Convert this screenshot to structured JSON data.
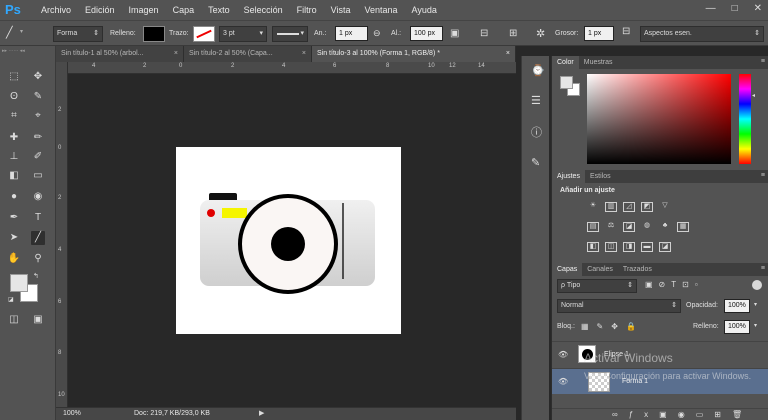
{
  "app": {
    "logo": "Ps"
  },
  "menu": [
    "Archivo",
    "Edición",
    "Imagen",
    "Capa",
    "Texto",
    "Selección",
    "Filtro",
    "Vista",
    "Ventana",
    "Ayuda"
  ],
  "window_controls": {
    "minimize": "—",
    "maximize": "□",
    "close": "✕"
  },
  "options": {
    "mode": "Forma",
    "fill_label": "Relleno:",
    "stroke_label": "Trazo:",
    "stroke_size": "3 pt",
    "width_label": "An.:",
    "width_value": "1 px",
    "height_label": "Al.:",
    "height_value": "100 px",
    "grosor_label": "Grosor:",
    "grosor_value": "1 px",
    "align_edges": "Aspectos esen."
  },
  "tabs": [
    {
      "label": "Sin título-1 al 50% (arbol...",
      "active": false
    },
    {
      "label": "Sin título-2 al 50% (Capa...",
      "active": false
    },
    {
      "label": "Sin título-3 al 100% (Forma 1, RGB/8) *",
      "active": true
    }
  ],
  "rulers": {
    "horizontal": [
      "4",
      "2",
      "0",
      "2",
      "4",
      "6",
      "8",
      "10",
      "12",
      "14"
    ],
    "vertical": [
      "2",
      "0",
      "2",
      "4",
      "6",
      "8",
      "10"
    ]
  },
  "status": {
    "zoom": "100%",
    "doc": "Doc: 219,7 KB/293,0 KB"
  },
  "panels": {
    "color_tabs": [
      "Color",
      "Muestras"
    ],
    "adjust_tabs": [
      "Ajustes",
      "Estilos"
    ],
    "adjust_title": "Añadir un ajuste",
    "layers_tabs": [
      "Capas",
      "Canales",
      "Trazados"
    ],
    "filter_label": "ρ Tipo",
    "blend_mode": "Normal",
    "opacity_label": "Opacidad:",
    "opacity_value": "100%",
    "lock_label": "Bloq.:",
    "fill_label": "Relleno:",
    "fill_value": "100%",
    "layers": [
      "Elipse 1",
      "Forma 1"
    ]
  },
  "watermark": {
    "line1": "Activar Windows",
    "line2": "Ve a Configuración para activar Windows."
  },
  "colors": {
    "accent": "#31a8ff",
    "selected_layer": "#5a6f8f",
    "flash_yellow": "#f5f500",
    "flash_red": "#e00000"
  }
}
